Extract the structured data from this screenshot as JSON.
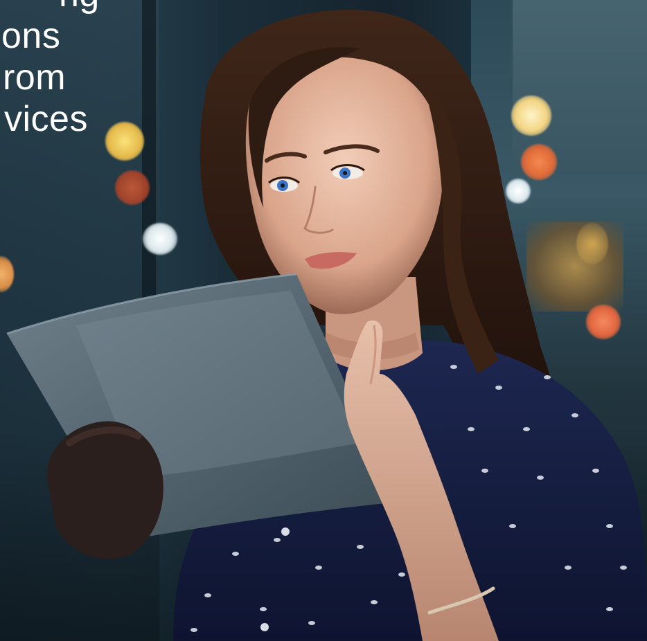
{
  "hero": {
    "headline_lines": [
      "ng",
      "ons",
      "rom",
      "vices"
    ]
  },
  "photo": {
    "subject": "woman-using-tablet",
    "colors": {
      "background": "#1c3240",
      "hair": "#3a2418",
      "skin": "#e8bda8",
      "shirt": "#141b38",
      "tablet": "#5d6e78",
      "bokeh_warm": "#f2a25a",
      "bokeh_cool": "#e6f0f3"
    }
  }
}
